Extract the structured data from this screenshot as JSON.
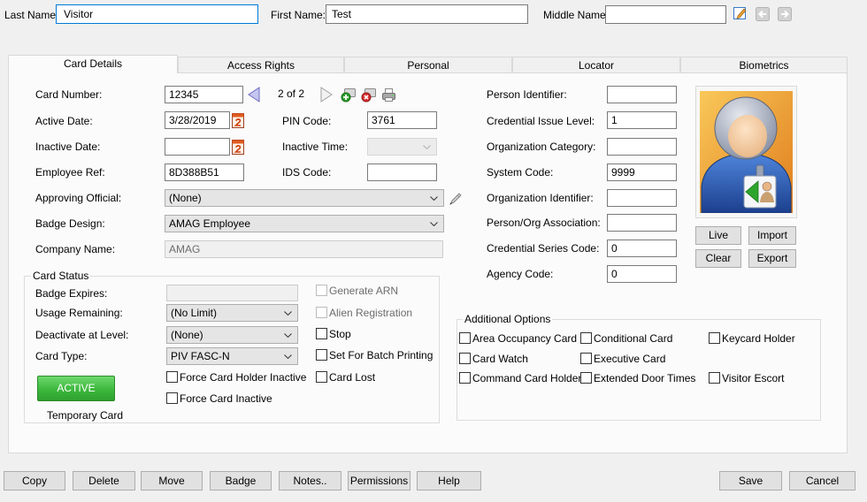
{
  "window": {
    "background": "#f0f0f0",
    "accent": "#0078d7"
  },
  "header": {
    "last_name": {
      "label": "Last Name:",
      "value": "Visitor"
    },
    "first_name": {
      "label": "First Name:",
      "value": "Test"
    },
    "middle_name": {
      "label": "Middle Name:",
      "value": ""
    },
    "icons": {
      "edit": "edit-icon",
      "prev": "previous-record-icon",
      "next": "next-record-icon"
    }
  },
  "tabs": [
    {
      "label": "Card Details",
      "active": true
    },
    {
      "label": "Access Rights",
      "active": false
    },
    {
      "label": "Personal",
      "active": false
    },
    {
      "label": "Locator",
      "active": false
    },
    {
      "label": "Biometrics",
      "active": false
    }
  ],
  "card_details": {
    "card_number": {
      "label": "Card Number:",
      "value": "12345"
    },
    "card_position": "2 of 2",
    "card_icons": [
      "previous-card-icon",
      "next-card-icon",
      "add-card-icon",
      "delete-card-icon",
      "print-card-icon"
    ],
    "active_date": {
      "label": "Active Date:",
      "value": "3/28/2019"
    },
    "inactive_date": {
      "label": "Inactive Date:",
      "value": ""
    },
    "employee_ref": {
      "label": "Employee Ref:",
      "value": "8D388B51"
    },
    "pin_code": {
      "label": "PIN Code:",
      "value": "3761"
    },
    "inactive_time": {
      "label": "Inactive Time:",
      "value": ""
    },
    "ids_code": {
      "label": "IDS Code:",
      "value": ""
    },
    "approving_official": {
      "label": "Approving Official:",
      "value": "(None)"
    },
    "badge_design": {
      "label": "Badge Design:",
      "value": "AMAG Employee"
    },
    "company_name": {
      "label": "Company Name:",
      "value": "AMAG"
    }
  },
  "card_status": {
    "title": "Card Status",
    "badge_expires": {
      "label": "Badge Expires:",
      "value": ""
    },
    "usage_remaining": {
      "label": "Usage Remaining:",
      "value": "(No Limit)"
    },
    "deactivate_at_level": {
      "label": "Deactivate at Level:",
      "value": "(None)"
    },
    "card_type": {
      "label": "Card Type:",
      "value": "PIV FASC-N"
    },
    "status_button": {
      "label": "ACTIVE",
      "color": "#3cb83c"
    },
    "temporary_card_label": "Temporary Card",
    "options": [
      {
        "label": "Force Card Holder Inactive",
        "checked": false
      },
      {
        "label": "Force Card Inactive",
        "checked": false
      },
      {
        "label": "Generate ARN",
        "checked": false,
        "enabled": false
      },
      {
        "label": "Alien Registration",
        "checked": false,
        "enabled": false
      },
      {
        "label": "Stop",
        "checked": false
      },
      {
        "label": "Set For Batch Printing",
        "checked": false
      },
      {
        "label": "Card Lost",
        "checked": false
      }
    ]
  },
  "identifiers": [
    {
      "label": "Person Identifier:",
      "value": ""
    },
    {
      "label": "Credential Issue Level:",
      "value": "1"
    },
    {
      "label": "Organization Category:",
      "value": ""
    },
    {
      "label": "System Code:",
      "value": "9999"
    },
    {
      "label": "Organization Identifier:",
      "value": ""
    },
    {
      "label": "Person/Org Association:",
      "value": ""
    },
    {
      "label": "Credential Series Code:",
      "value": "0"
    },
    {
      "label": "Agency Code:",
      "value": "0"
    }
  ],
  "photo": {
    "icon": "cardholder-photo-placeholder-icon",
    "buttons": {
      "live": "Live",
      "import": "Import",
      "clear": "Clear",
      "export": "Export"
    }
  },
  "additional_options": {
    "title": "Additional Options",
    "items": [
      {
        "label": "Area Occupancy Card",
        "checked": false
      },
      {
        "label": "Conditional Card",
        "checked": false
      },
      {
        "label": "Keycard Holder",
        "checked": false
      },
      {
        "label": "Card Watch",
        "checked": false
      },
      {
        "label": "Executive Card",
        "checked": false
      },
      {
        "label": "Command Card Holder",
        "checked": false
      },
      {
        "label": "Extended Door Times",
        "checked": false
      },
      {
        "label": "Visitor Escort",
        "checked": false
      }
    ]
  },
  "footer": {
    "left_buttons": [
      "Copy",
      "Delete",
      "Move",
      "Badge",
      "Notes..",
      "Permissions",
      "Help"
    ],
    "save": "Save",
    "cancel": "Cancel"
  }
}
